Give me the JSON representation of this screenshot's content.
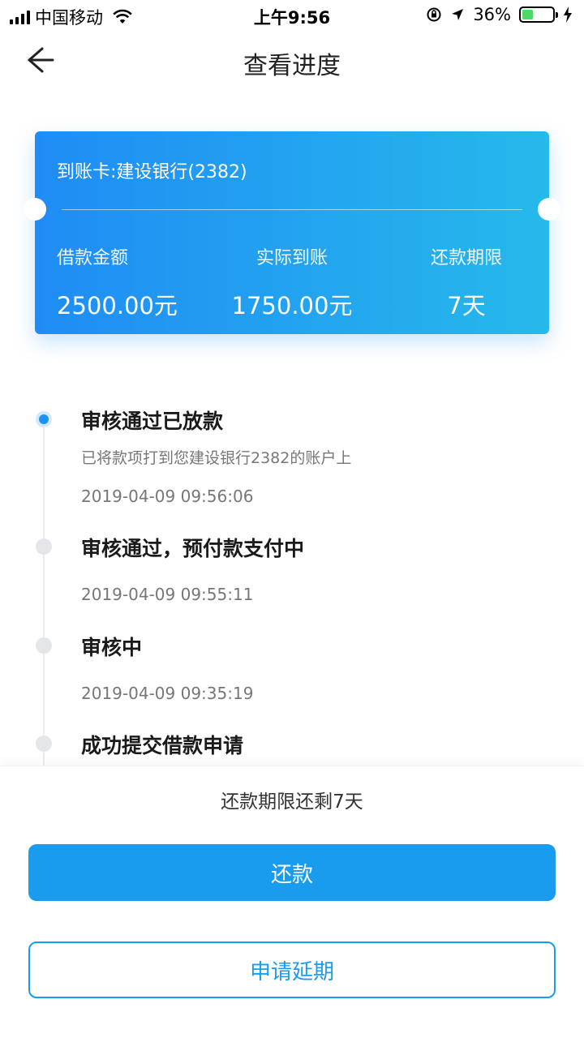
{
  "status_bar": {
    "carrier": "中国移动",
    "time": "上午9:56",
    "battery": "36%",
    "battery_level": 0.36,
    "icons": [
      "signal-icon",
      "wifi-icon",
      "orientation-lock-icon",
      "location-arrow-icon",
      "battery-icon",
      "charging-bolt-icon"
    ]
  },
  "nav": {
    "title": "查看进度",
    "back_icon": "arrow-left-icon"
  },
  "card": {
    "account": "到账卡:建设银行(2382)",
    "stats": [
      {
        "label": "借款金额",
        "value": "2500.00元"
      },
      {
        "label": "实际到账",
        "value": "1750.00元"
      },
      {
        "label": "还款期限",
        "value": "7天"
      }
    ],
    "gradient_start": "#1f8cf5",
    "gradient_end": "#26b9ea"
  },
  "timeline": [
    {
      "title": "审核通过已放款",
      "desc": "已将款项打到您建设银行2382的账户上",
      "time": "2019-04-09 09:56:06",
      "active": true
    },
    {
      "title": "审核通过，预付款支付中",
      "desc": "",
      "time": "2019-04-09 09:55:11",
      "active": false
    },
    {
      "title": "审核中",
      "desc": "",
      "time": "2019-04-09 09:35:19",
      "active": false
    },
    {
      "title": "成功提交借款申请",
      "desc": "",
      "time": "",
      "active": false
    }
  ],
  "bottom": {
    "remaining": "还款期限还剩7天",
    "repay_label": "还款",
    "extend_label": "申请延期"
  },
  "colors": {
    "accent": "#1a9cee",
    "active_dot": "#1e93ee",
    "inactive_dot": "#e4e6ea"
  }
}
